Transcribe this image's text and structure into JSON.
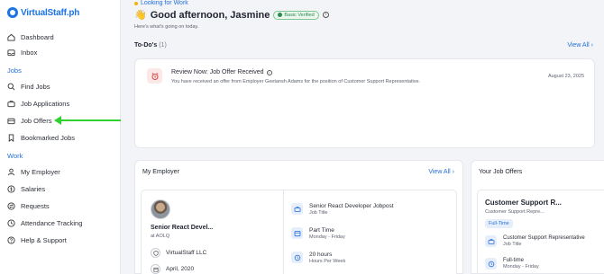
{
  "brand": {
    "logo_text": "VirtualStaff.ph",
    "accent": "#1b74e4"
  },
  "sidebar": {
    "items_top": [
      {
        "label": "Dashboard",
        "icon": "home-icon"
      },
      {
        "label": "Inbox",
        "icon": "inbox-icon"
      }
    ],
    "section_jobs": "Jobs",
    "items_jobs": [
      {
        "label": "Find Jobs",
        "icon": "search-icon"
      },
      {
        "label": "Job Applications",
        "icon": "briefcase-icon"
      },
      {
        "label": "Job Offers",
        "icon": "offer-icon"
      },
      {
        "label": "Bookmarked Jobs",
        "icon": "bookmark-icon"
      }
    ],
    "section_work": "Work",
    "items_work": [
      {
        "label": "My Employer",
        "icon": "user-icon"
      },
      {
        "label": "Salaries",
        "icon": "money-icon"
      },
      {
        "label": "Requests",
        "icon": "swap-icon"
      },
      {
        "label": "Attendance Tracking",
        "icon": "clock-icon"
      },
      {
        "label": "Help & Support",
        "icon": "help-icon"
      }
    ]
  },
  "header": {
    "status": "Looking for Work",
    "greeting": "Good afternoon, Jasmine",
    "wave": "👋",
    "badge": "Basic Verified",
    "subtitle": "Here's what's going on today."
  },
  "todos": {
    "title": "To-Do's",
    "count": "(1)",
    "view_all": "View All",
    "item": {
      "title": "Review Now: Job Offer Received",
      "description": "You have received an offer from Employer Geetansh Adams for the position of Customer Support Representative.",
      "date": "August 23, 2025"
    }
  },
  "employer": {
    "title": "My Employer",
    "view_all": "View All",
    "role": "Senior React Devel...",
    "company": "at AOLQ",
    "org": "VirtualStaff LLC",
    "date": "April, 2020",
    "details": [
      {
        "value": "Senior React Developer Jobpost",
        "label": "Job Title"
      },
      {
        "value": "Part Time",
        "label": "Monday - Friday"
      },
      {
        "value": "20 hours",
        "label": "Hours Per Week"
      }
    ]
  },
  "job_offers": {
    "title": "Your Job Offers",
    "job_title": "Customer Support R...",
    "job_sub": "Customer Support Repre...",
    "pill": "Full-Time",
    "details": [
      {
        "value": "Customer Support Representative",
        "label": "Job Title"
      },
      {
        "value": "Full-time",
        "label": "Monday - Friday"
      }
    ]
  }
}
